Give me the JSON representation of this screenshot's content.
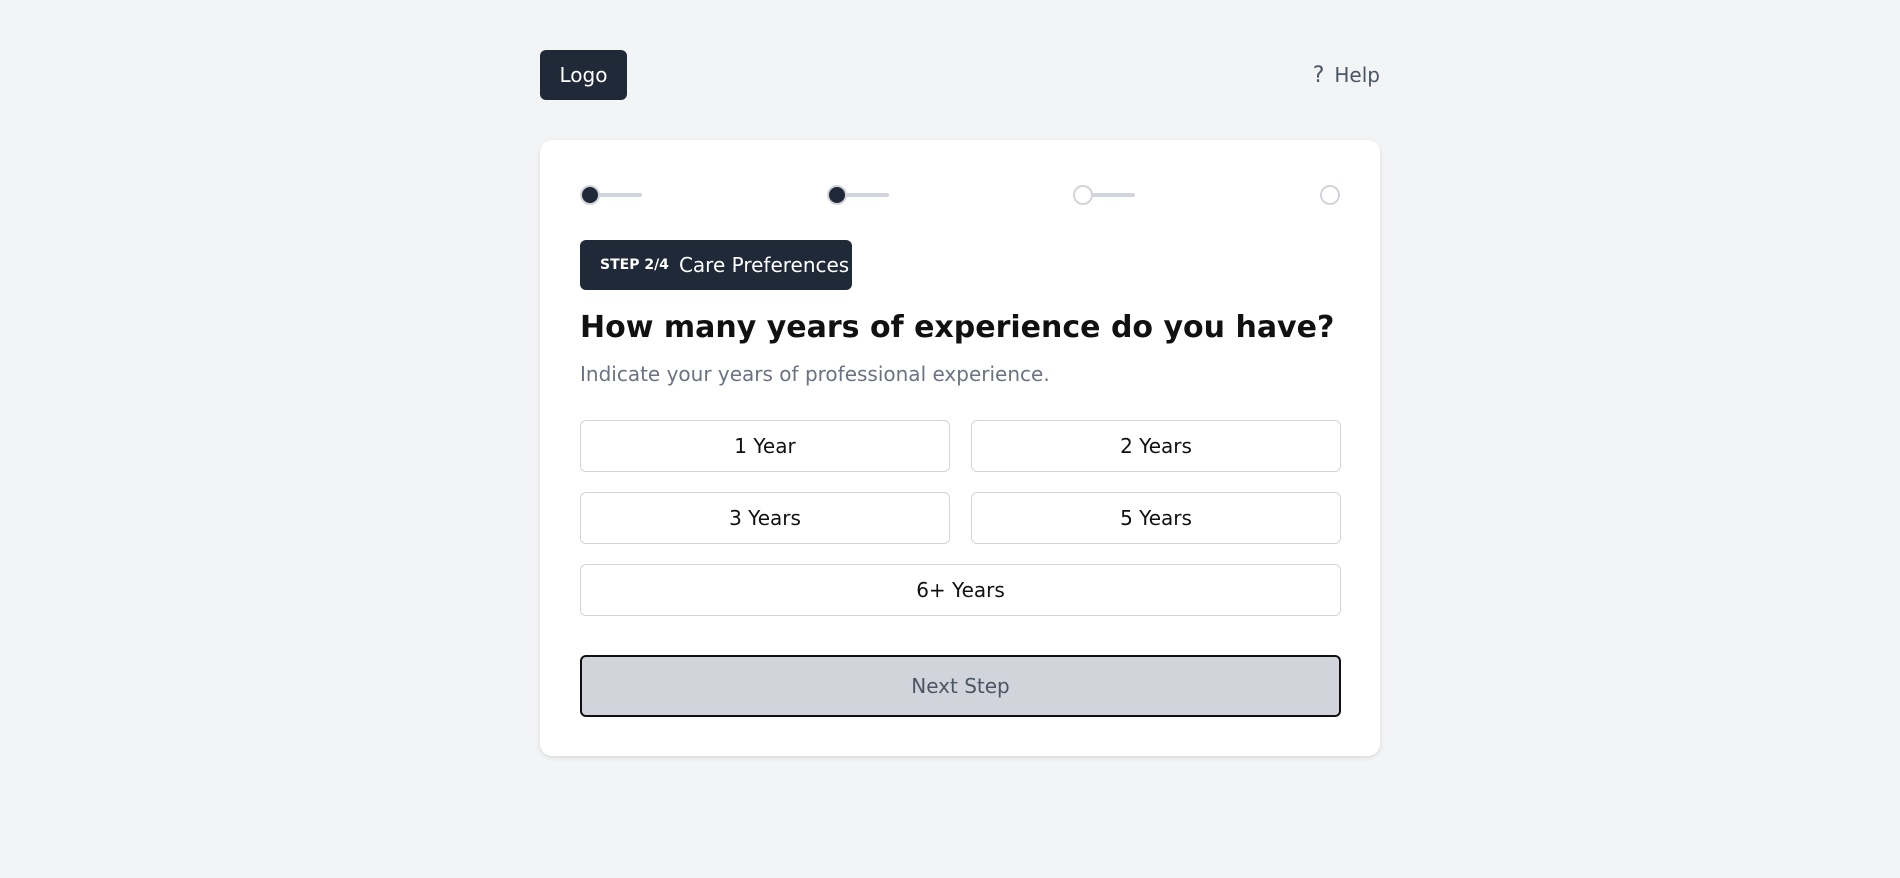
{
  "header": {
    "logo_label": "Logo",
    "help_icon": "?",
    "help_label": "Help"
  },
  "progress": {
    "current_step": 2,
    "total_steps": 4
  },
  "step_badge": {
    "number": "STEP 2/4",
    "label": "Care Preferences"
  },
  "question": {
    "title": "How many years of experience do you have?",
    "subtitle": "Indicate your years of professional experience."
  },
  "options": [
    {
      "label": "1 Year"
    },
    {
      "label": "2 Years"
    },
    {
      "label": "3 Years"
    },
    {
      "label": "5 Years"
    },
    {
      "label": "6+ Years"
    }
  ],
  "next_button": {
    "label": "Next Step"
  },
  "colors": {
    "background": "#f3f4f6",
    "primary": "#1f2937",
    "muted": "#6b7280",
    "border": "#d1d5db",
    "button_disabled": "#d1d5db"
  }
}
